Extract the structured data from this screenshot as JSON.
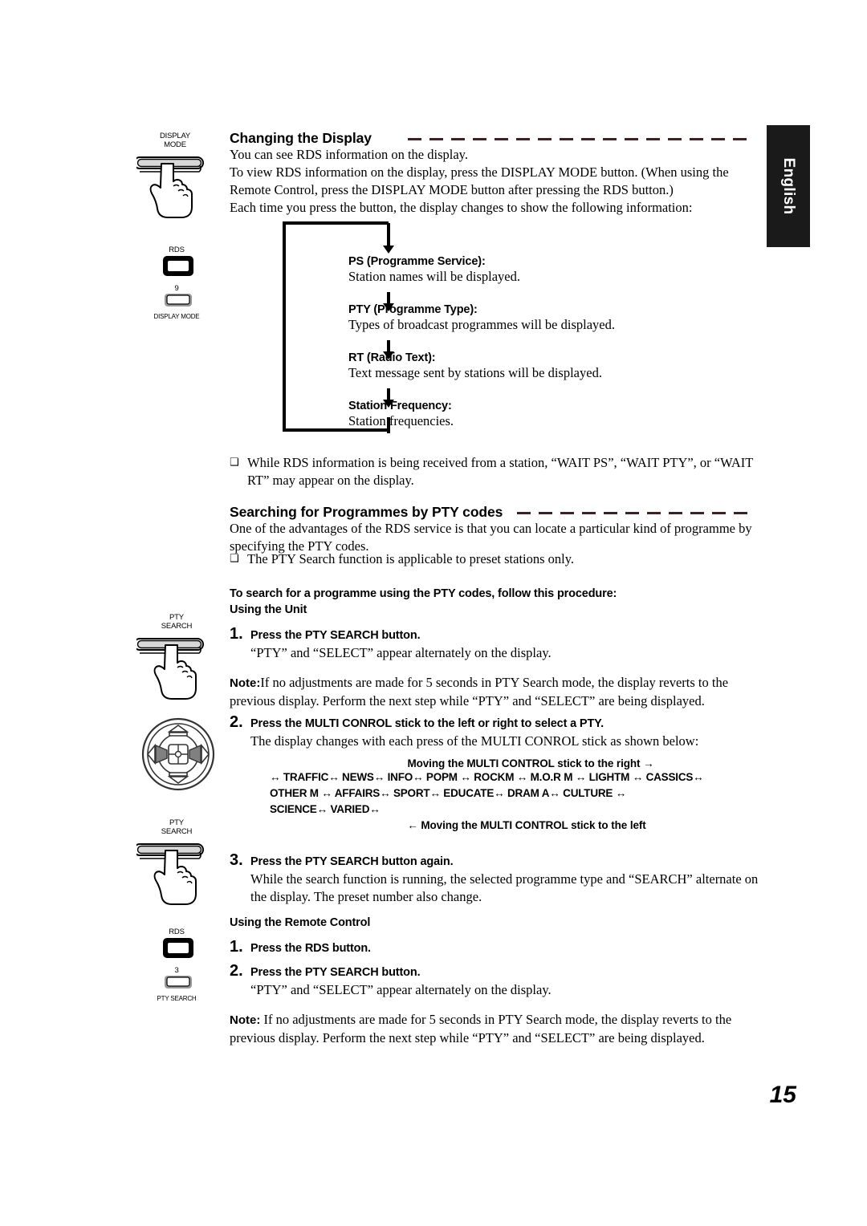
{
  "page": {
    "number": "15",
    "language_tab": "English"
  },
  "section1": {
    "heading": "Changing the Display",
    "paragraphs": [
      "You can see RDS information on the display.",
      "To view RDS information on the display, press the DISPLAY MODE button. (When using the Remote Control, press the DISPLAY MODE button after pressing the RDS button.)",
      "Each time you press the button, the display changes to show the following information:"
    ],
    "flow": [
      {
        "title": "PS (Programme Service):",
        "desc": "Station names will be displayed."
      },
      {
        "title": "PTY (Programme Type):",
        "desc": "Types of broadcast programmes will be displayed."
      },
      {
        "title": "RT (Radio Text):",
        "desc": "Text message sent by stations will be displayed."
      },
      {
        "title": "Station Frequency:",
        "desc": "Station frequencies."
      }
    ],
    "note_bullet": "While RDS information is being received from a station, “WAIT PS”, “WAIT PTY”, or “WAIT RT” may appear on the display."
  },
  "section2": {
    "heading": "Searching for Programmes by PTY codes",
    "intro": "One of the advantages of the RDS service is that you can locate a particular kind of programme by specifying the PTY codes.",
    "bullet": "The PTY Search function is applicable to preset stations only.",
    "procedure_lead": "To search for a programme using the PTY codes, follow this procedure:",
    "subhead_unit": "Using the Unit",
    "subhead_remote": "Using the Remote Control",
    "steps_unit": [
      {
        "num": "1.",
        "title": "Press the PTY SEARCH button.",
        "body": "“PTY” and “SELECT” appear alternately on the display."
      },
      {
        "num": "2.",
        "title": "Press the MULTI CONROL stick to the left or right to select a PTY.",
        "body": "The display changes with each press of the MULTI CONROL stick as shown below:"
      },
      {
        "num": "3.",
        "title": "Press the PTY SEARCH button again.",
        "body": "While the search function is running, the selected programme type and “SEARCH” alternate on the display. The preset number also change."
      }
    ],
    "note_unit": {
      "label": "Note:",
      "text": "If no adjustments are made for 5 seconds in PTY Search mode, the display reverts to the previous display. Perform the next step while “PTY” and “SELECT” are being displayed."
    },
    "steps_remote": [
      {
        "num": "1.",
        "title": "Press the RDS button.",
        "body": ""
      },
      {
        "num": "2.",
        "title": "Press the PTY SEARCH button.",
        "body": "“PTY” and “SELECT” appear alternately on the display."
      }
    ],
    "note_remote": {
      "label": "Note:",
      "text": "If no adjustments are made for 5 seconds in PTY Search mode, the display reverts to the previous display. Perform the next step while “PTY” and “SELECT” are being displayed."
    },
    "pty_list": {
      "direction_right": "Moving the MULTI CONTROL stick to the right",
      "direction_left": "Moving the MULTI CONTROL stick to the left",
      "arrow_right": "→",
      "arrow_left": "←",
      "separator": "↔",
      "line1": "↔ TRAFFIC↔ NEWS↔ INFO↔ POPM ↔ ROCKM ↔ M.O.R M ↔ LIGHTM ↔ CASSICS↔",
      "line2": "OTHER M ↔  AFFAIRS↔  SPORT↔  EDUCATE↔  DRAM A↔  CULTURE ↔",
      "line3": "SCIENCE↔  VARIED↔",
      "codes": [
        "TRAFFIC",
        "NEWS",
        "INFO",
        "POPM",
        "ROCKM",
        "M.O.R M",
        "LIGHTM",
        "CASSICS",
        "OTHER M",
        "AFFAIRS",
        "SPORT",
        "EDUCATE",
        "DRAM A",
        "CULTURE",
        "SCIENCE",
        "VARIED"
      ]
    }
  },
  "illustrations": {
    "display_mode_press": {
      "line1": "DISPLAY",
      "line2": "MODE"
    },
    "remote_top": {
      "rds_label": "RDS",
      "num": "9",
      "caption": "DISPLAY MODE"
    },
    "pty_search_press_1": {
      "line1": "PTY",
      "line2": "SEARCH"
    },
    "multi_control": {
      "name": "multi-control-stick"
    },
    "pty_search_press_2": {
      "line1": "PTY",
      "line2": "SEARCH"
    },
    "remote_bottom": {
      "rds_label": "RDS",
      "num": "3",
      "caption": "PTY SEARCH"
    }
  }
}
